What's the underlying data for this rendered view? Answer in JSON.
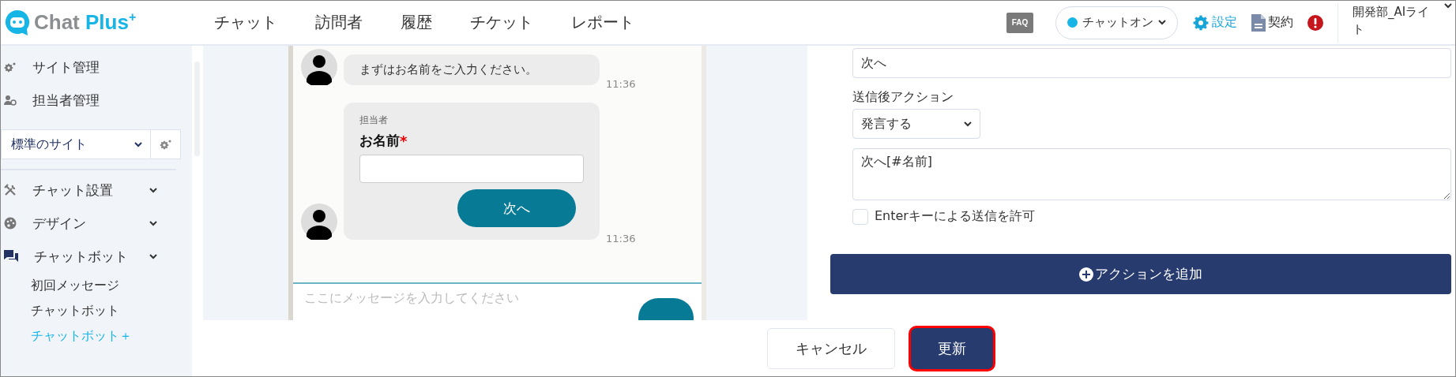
{
  "header": {
    "logo": {
      "first": "Chat",
      "second": "Plus",
      "sup": "+"
    },
    "nav": [
      {
        "label": "チャット"
      },
      {
        "label": "訪問者"
      },
      {
        "label": "履歴"
      },
      {
        "label": "チケット"
      },
      {
        "label": "レポート"
      }
    ],
    "faq": "FAQ",
    "status": {
      "label": "チャットオン",
      "on": true
    },
    "settings": "設定",
    "contract": "契約",
    "user": "開発部_AIライト"
  },
  "sidebar": {
    "top_items": [
      {
        "label": "サイト管理",
        "kind": "gear"
      },
      {
        "label": "担当者管理",
        "kind": "users"
      }
    ],
    "site_select": "標準のサイト",
    "menu": [
      {
        "label": "チャット設置",
        "kind": "tools"
      },
      {
        "label": "デザイン",
        "kind": "palette"
      },
      {
        "label": "チャットボット",
        "kind": "chat",
        "children": [
          {
            "label": "初回メッセージ",
            "selected": false
          },
          {
            "label": "チャットボット",
            "selected": false
          },
          {
            "label": "チャットボット＋",
            "selected": true
          }
        ]
      }
    ]
  },
  "chat_preview": {
    "messages": [
      {
        "kind": "text",
        "text": "まずはお名前をご入力ください。",
        "time": "11:36"
      },
      {
        "kind": "form",
        "sender": "担当者",
        "field_label": "お名前",
        "required_mark": "*",
        "button": "次へ",
        "time": "11:36"
      }
    ],
    "input_placeholder": "ここにメッセージを入力してください"
  },
  "action_panel": {
    "button_label_value": "次へ",
    "after_action_label": "送信後アクション",
    "after_action": "発言する",
    "message": "次へ[#名前]",
    "enter_to_send": {
      "label": "Enterキーによる送信を許可",
      "checked": false
    },
    "add_action": "アクションを追加"
  },
  "footer": {
    "cancel": "キャンセル",
    "update": "更新",
    "update_focused": true
  }
}
